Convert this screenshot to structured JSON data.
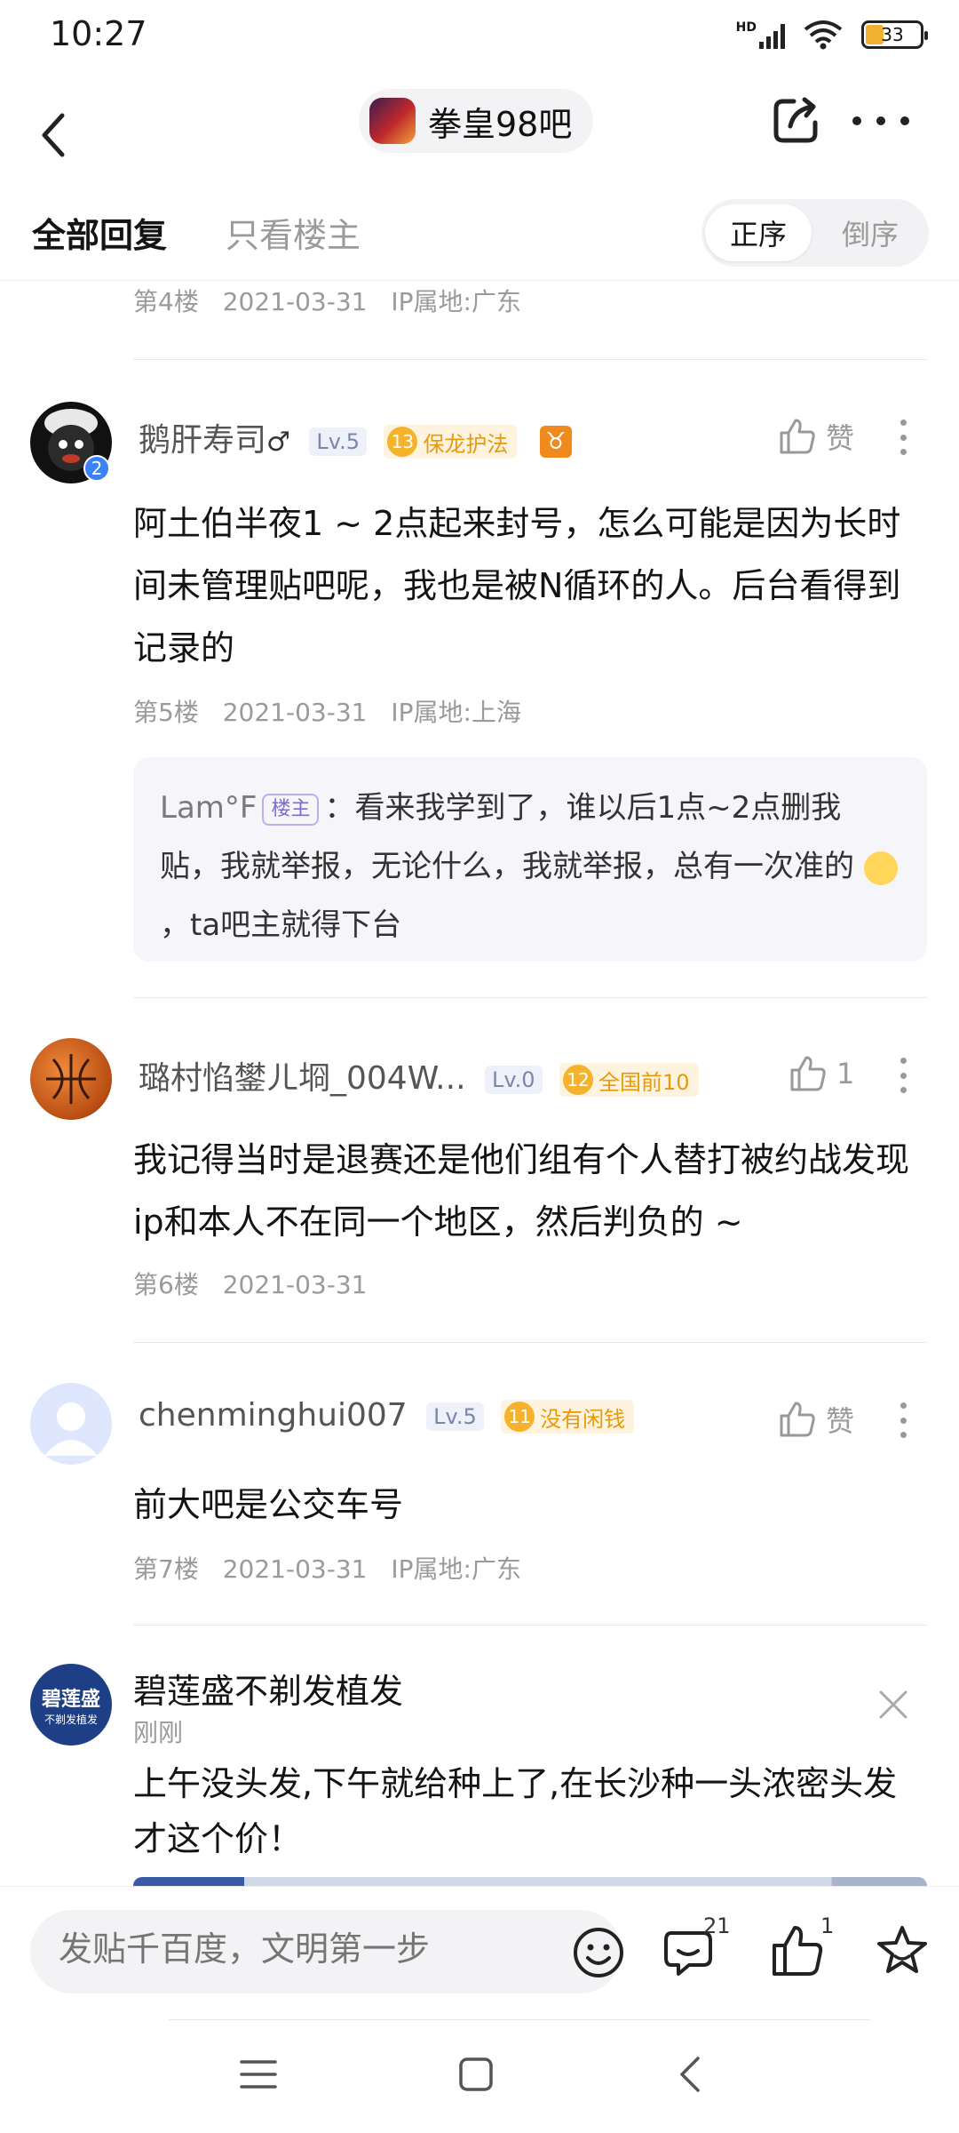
{
  "status_bar": {
    "time": "10:27",
    "network": "HD",
    "battery": "33"
  },
  "nav": {
    "forum_name": "拳皇98吧"
  },
  "tabs": {
    "all": "全部回复",
    "op_only": "只看楼主",
    "sort_asc": "正序",
    "sort_desc": "倒序"
  },
  "floor4": {
    "floor": "第4楼",
    "date": "2021-03-31",
    "ip": "IP属地:广东"
  },
  "floor5": {
    "username": "鹅肝寿司",
    "gender": "♂",
    "level": "Lv.5",
    "badge_level": "13",
    "badge_name": "保龙护法",
    "zodiac": "♉",
    "avatar_badge": "2",
    "like_label": "赞",
    "content": "阿土伯半夜1 ~ 2点起来封号，怎么可能是因为长时间未管理贴吧呢，我也是被N循环的人。后台看得到记录的",
    "floor": "第5楼",
    "date": "2021-03-31",
    "ip": "IP属地:上海",
    "reply": {
      "username": "Lam°F",
      "tag": "楼主",
      "text_before": "：看来我学到了，谁以后1点~2点删我贴，我就举报，无论什么，我就举报，总有一次准的",
      "text_after": "，ta吧主就得下台"
    }
  },
  "floor6": {
    "username": "璐村惂鐢ㄦ埛_004W...",
    "level": "Lv.0",
    "badge_level": "12",
    "badge_name": "全国前10",
    "like_count": "1",
    "content": "我记得当时是退赛还是他们组有个人替打被约战发现ip和本人不在同一个地区，然后判负的 ~",
    "floor": "第6楼",
    "date": "2021-03-31"
  },
  "floor7": {
    "username": "chenminghui007",
    "level": "Lv.5",
    "badge_level": "11",
    "badge_name": "没有闲钱",
    "like_label": "赞",
    "content": "前大吧是公交车号",
    "floor": "第7楼",
    "date": "2021-03-31",
    "ip": "IP属地:广东"
  },
  "ad": {
    "logo_line1": "碧莲盛",
    "logo_line2": "不剃发植发",
    "title": "碧莲盛不剃发植发",
    "time": "刚刚",
    "content": "上午没头发,下午就给种上了,在长沙种一头浓密头发才这个价！"
  },
  "bottom_bar": {
    "placeholder": "发贴千百度，文明第一步",
    "comment_count": "21",
    "like_count": "1"
  },
  "colors": {
    "badge_gold": "#f5b22d",
    "owner_tag": "#7a6bd6",
    "level_bg": "#eef1fa"
  }
}
